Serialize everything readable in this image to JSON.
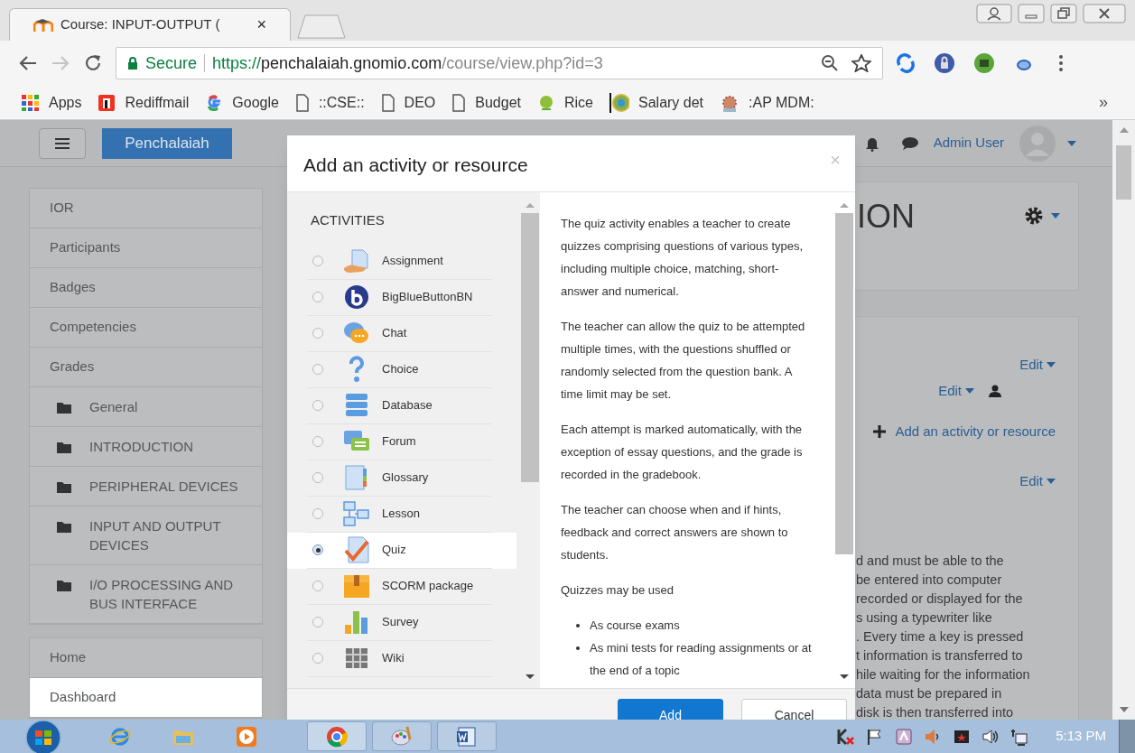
{
  "browser": {
    "tab_title": "Course: INPUT-OUTPUT (",
    "tab_close": "×",
    "secure_label": "Secure",
    "url_scheme": "https://",
    "url_host": "penchalaiah.gnomio.com",
    "url_path": "/course/view.php?id=3",
    "bookmarks": [
      {
        "label": "Apps"
      },
      {
        "label": "Rediffmail"
      },
      {
        "label": "Google"
      },
      {
        "label": "::CSE::"
      },
      {
        "label": "DEO"
      },
      {
        "label": "Budget"
      },
      {
        "label": "Rice"
      },
      {
        "label": "Salary det"
      },
      {
        "label": ":AP MDM:"
      }
    ],
    "bookmarks_overflow": "»"
  },
  "navbar": {
    "site_name": "Penchalaiah",
    "user_name": "Admin User"
  },
  "sidebar": {
    "items": [
      {
        "kind": "link",
        "label": "IOR"
      },
      {
        "kind": "link",
        "label": "Participants"
      },
      {
        "kind": "link",
        "label": "Badges"
      },
      {
        "kind": "link",
        "label": "Competencies"
      },
      {
        "kind": "link",
        "label": "Grades"
      },
      {
        "kind": "section",
        "label": "General"
      },
      {
        "kind": "section",
        "label": "INTRODUCTION"
      },
      {
        "kind": "section",
        "label": "PERIPHERAL DEVICES"
      },
      {
        "kind": "section",
        "label": "INPUT AND OUTPUT DEVICES"
      },
      {
        "kind": "section",
        "label": "I/O PROCESSING AND BUS INTERFACE"
      }
    ],
    "bottom_items": [
      {
        "label": "Home"
      },
      {
        "label": "Dashboard"
      }
    ]
  },
  "course": {
    "heading": "ION",
    "edit_links": [
      "Edit",
      "Edit",
      "Edit"
    ],
    "add_link": "Add an activity or resource",
    "text_lines": [
      "d and must be able to the",
      "be entered into computer",
      "recorded or displayed for the",
      "s using a typewriter like",
      ". Every time a key is pressed",
      "t information is transferred to",
      "hile waiting for the information",
      "data must be prepared in",
      "disk is then transferred into"
    ]
  },
  "modal": {
    "title": "Add an activity or resource",
    "close": "×",
    "section_heading": "ACTIVITIES",
    "activities": [
      {
        "label": "Assignment",
        "selected": false
      },
      {
        "label": "BigBlueButtonBN",
        "selected": false
      },
      {
        "label": "Chat",
        "selected": false
      },
      {
        "label": "Choice",
        "selected": false
      },
      {
        "label": "Database",
        "selected": false
      },
      {
        "label": "Forum",
        "selected": false
      },
      {
        "label": "Glossary",
        "selected": false
      },
      {
        "label": "Lesson",
        "selected": false
      },
      {
        "label": "Quiz",
        "selected": true
      },
      {
        "label": "SCORM package",
        "selected": false
      },
      {
        "label": "Survey",
        "selected": false
      },
      {
        "label": "Wiki",
        "selected": false
      }
    ],
    "description": [
      "The quiz activity enables a teacher to create quizzes comprising questions of various types, including multiple choice, matching, short-answer and numerical.",
      "The teacher can allow the quiz to be attempted multiple times, with the questions shuffled or randomly selected from the question bank. A time limit may be set.",
      "Each attempt is marked automatically, with the exception of essay questions, and the grade is recorded in the gradebook.",
      "The teacher can choose when and if hints, feedback and correct answers are shown to students.",
      "Quizzes may be used"
    ],
    "bullets": [
      "As course exams",
      "As mini tests for reading assignments or at the end of a topic"
    ],
    "buttons": [
      {
        "kind": "primary",
        "label": "Add"
      },
      {
        "kind": "secondary",
        "label": "Cancel"
      }
    ]
  },
  "taskbar": {
    "clock": "5:13 PM"
  }
}
